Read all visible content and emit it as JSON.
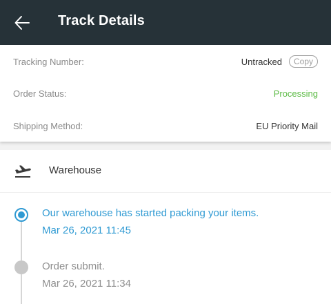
{
  "header": {
    "title": "Track Details",
    "back_icon": "arrow-left-icon"
  },
  "info": {
    "tracking_number": {
      "label": "Tracking Number:",
      "value": "Untracked",
      "copy_label": "Copy"
    },
    "order_status": {
      "label": "Order Status:",
      "value": "Processing",
      "color": "#5dbb46"
    },
    "shipping_method": {
      "label": "Shipping Method:",
      "value": "EU Priority Mail"
    }
  },
  "warehouse": {
    "icon": "plane-takeoff-icon",
    "label": "Warehouse"
  },
  "events": [
    {
      "message": "Our warehouse has started packing your items.",
      "time": "Mar 26, 2021 11:45",
      "state": "active"
    },
    {
      "message": "Order submit.",
      "time": "Mar 26, 2021 11:34",
      "state": "done"
    }
  ],
  "colors": {
    "header_bg": "#263238",
    "accent": "#2f9ad3",
    "status_green": "#5dbb46"
  }
}
